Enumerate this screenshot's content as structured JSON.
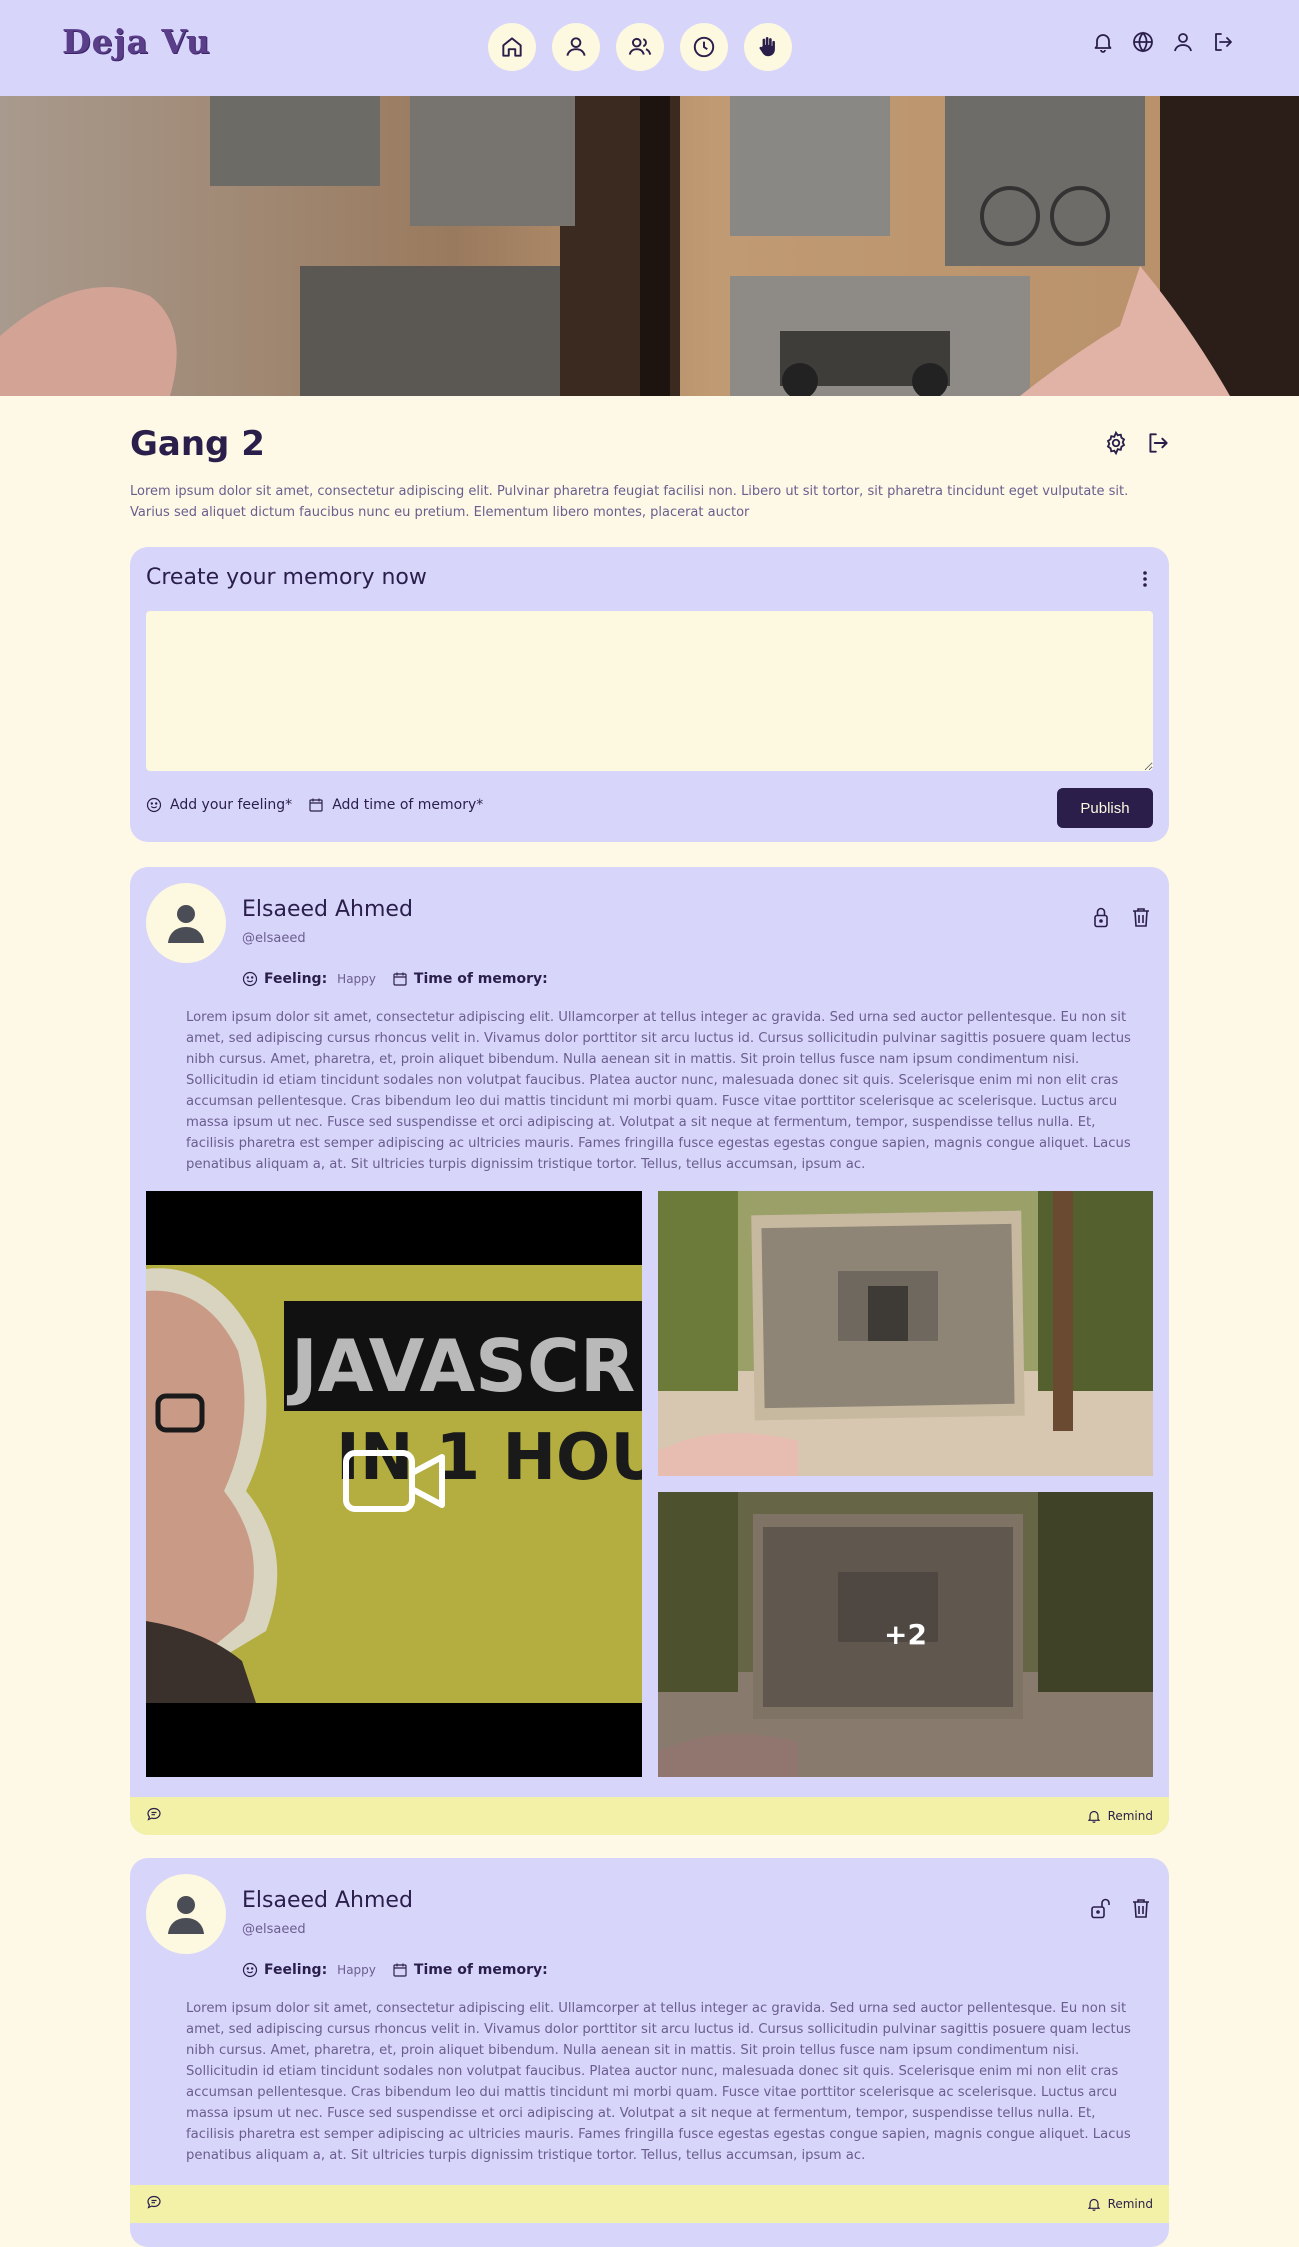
{
  "app": {
    "logo": "Deja Vu"
  },
  "nav": [
    "home-icon",
    "profile-icon",
    "friends-icon",
    "history-icon",
    "hand-icon"
  ],
  "header_actions": [
    "bell-icon",
    "globe-icon",
    "user-icon",
    "logout-icon"
  ],
  "group": {
    "title": "Gang 2",
    "description": "Lorem ipsum dolor sit amet, consectetur adipiscing elit. Pulvinar pharetra feugiat facilisi non. Libero ut sit tortor, sit pharetra tincidunt eget vulputate sit. Varius sed aliquet dictum faucibus nunc eu pretium. Elementum libero montes, placerat auctor"
  },
  "composer": {
    "title": "Create your memory now",
    "feeling_label": "Add your feeling*",
    "time_label": "Add time of memory*",
    "publish_label": "Publish"
  },
  "posts": [
    {
      "author": "Elsaeed Ahmed",
      "handle": "@elsaeed",
      "feeling_label": "Feeling:",
      "feeling_value": "Happy",
      "time_label": "Time of memory:",
      "lock_state": "locked",
      "body": "Lorem ipsum dolor sit amet, consectetur adipiscing elit. Ullamcorper at tellus integer ac gravida. Sed urna sed auctor pellentesque. Eu non sit amet, sed adipiscing cursus rhoncus velit in. Vivamus dolor porttitor sit arcu luctus id. Cursus sollicitudin pulvinar sagittis posuere quam lectus nibh cursus. Amet, pharetra, et, proin aliquet bibendum. Nulla aenean sit in mattis. Sit proin tellus fusce nam ipsum condimentum nisi. Sollicitudin id etiam tincidunt sodales non volutpat faucibus. Platea auctor nunc, malesuada donec sit quis. Scelerisque enim mi non elit cras accumsan pellentesque. Cras bibendum leo dui mattis tincidunt mi morbi quam. Fusce vitae porttitor scelerisque ac scelerisque. Luctus arcu massa ipsum ut nec. Fusce sed suspendisse et orci adipiscing at. Volutpat a sit neque at fermentum, tempor, suspendisse tellus nulla. Et, facilisis pharetra est semper adipiscing ac ultricies mauris. Fames fringilla fusce egestas egestas congue sapien, magnis congue aliquet. Lacus penatibus aliquam a, at. Sit ultricies turpis dignissim tristique tortor. Tellus, tellus accumsan, ipsum ac.",
      "video_text_1": "JAVASCR",
      "video_text_2": "IN 1 HOU",
      "more_count": "+2",
      "remind_label": "Remind"
    },
    {
      "author": "Elsaeed Ahmed",
      "handle": "@elsaeed",
      "feeling_label": "Feeling:",
      "feeling_value": "Happy",
      "time_label": "Time of memory:",
      "lock_state": "unlocked",
      "body": "Lorem ipsum dolor sit amet, consectetur adipiscing elit. Ullamcorper at tellus integer ac gravida. Sed urna sed auctor pellentesque. Eu non sit amet, sed adipiscing cursus rhoncus velit in. Vivamus dolor porttitor sit arcu luctus id. Cursus sollicitudin pulvinar sagittis posuere quam lectus nibh cursus. Amet, pharetra, et, proin aliquet bibendum. Nulla aenean sit in mattis. Sit proin tellus fusce nam ipsum condimentum nisi. Sollicitudin id etiam tincidunt sodales non volutpat faucibus. Platea auctor nunc, malesuada donec sit quis. Scelerisque enim mi non elit cras accumsan pellentesque. Cras bibendum leo dui mattis tincidunt mi morbi quam. Fusce vitae porttitor scelerisque ac scelerisque. Luctus arcu massa ipsum ut nec. Fusce sed suspendisse et orci adipiscing at. Volutpat a sit neque at fermentum, tempor, suspendisse tellus nulla. Et, facilisis pharetra est semper adipiscing ac ultricies mauris. Fames fringilla fusce egestas egestas congue sapien, magnis congue aliquet. Lacus penatibus aliquam a, at. Sit ultricies turpis dignissim tristique tortor. Tellus, tellus accumsan, ipsum ac.",
      "remind_label": "Remind"
    }
  ],
  "colors": {
    "page_bg": "#fdf9e6",
    "header_bg": "#d8d5fb",
    "card_bg": "#d8d5fb",
    "footer_bg": "#f3f1a8",
    "primary": "#2b1e4a"
  }
}
